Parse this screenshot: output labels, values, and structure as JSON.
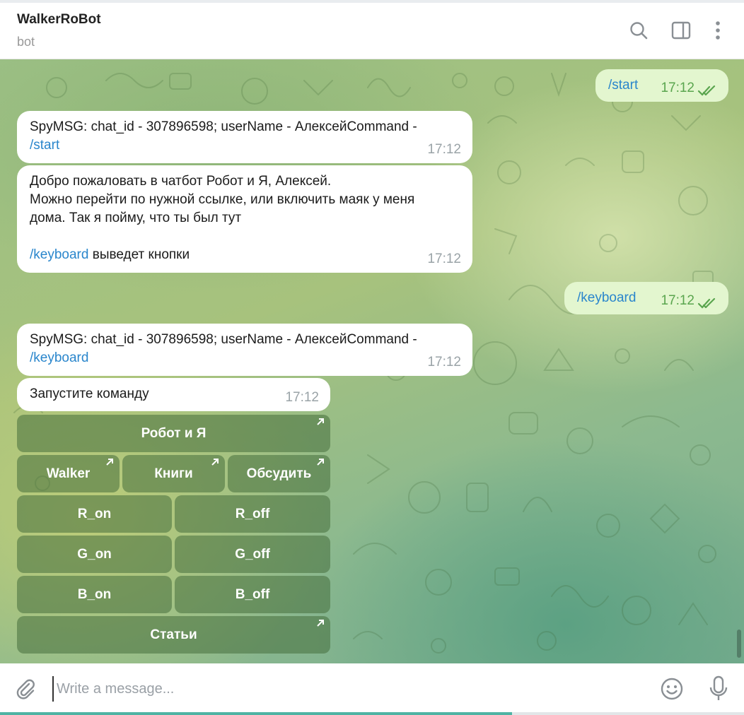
{
  "header": {
    "title": "WalkerRoBot",
    "subtitle": "bot",
    "icons": [
      "search-icon",
      "sidebar-toggle-icon",
      "more-menu-icon"
    ]
  },
  "messages": [
    {
      "direction": "out",
      "text": "/start",
      "time": "17:12",
      "status": "read"
    },
    {
      "direction": "in",
      "text": "SpyMSG: chat_id - 307896598; userName - АлексейCommand -",
      "link": "/start",
      "time": "17:12"
    },
    {
      "direction": "in",
      "line1": "Добро пожаловать в  чатбот Робот и Я, Алексей.",
      "line2": "Можно перейти по нужной ссылке, или включить маяк у меня",
      "line3": "дома. Так я пойму, что ты был тут",
      "link": "/keyboard",
      "after_link": " выведет кнопки",
      "time": "17:12"
    },
    {
      "direction": "out",
      "text": "/keyboard",
      "time": "17:12",
      "status": "read"
    },
    {
      "direction": "in",
      "text": "SpyMSG: chat_id - 307896598; userName - АлексейCommand -",
      "link": "/keyboard",
      "time": "17:12"
    },
    {
      "direction": "in",
      "text": "Запустите команду",
      "time": "17:12"
    }
  ],
  "keyboard": {
    "robot_i_ya": "Робот и Я",
    "walker": "Walker",
    "knigi": "Книги",
    "obsudit": "Обсудить",
    "r_on": "R_on",
    "r_off": "R_off",
    "g_on": "G_on",
    "g_off": "G_off",
    "b_on": "B_on",
    "b_off": "B_off",
    "stati": "Статьи"
  },
  "composer": {
    "placeholder": "Write a message...",
    "value": ""
  },
  "colors": {
    "outgoing_bubble": "#e3f6cf",
    "incoming_bubble": "#ffffff",
    "link": "#2a86cc",
    "read_check": "#5aa54e",
    "upload_progress": "#4fb3a3"
  }
}
